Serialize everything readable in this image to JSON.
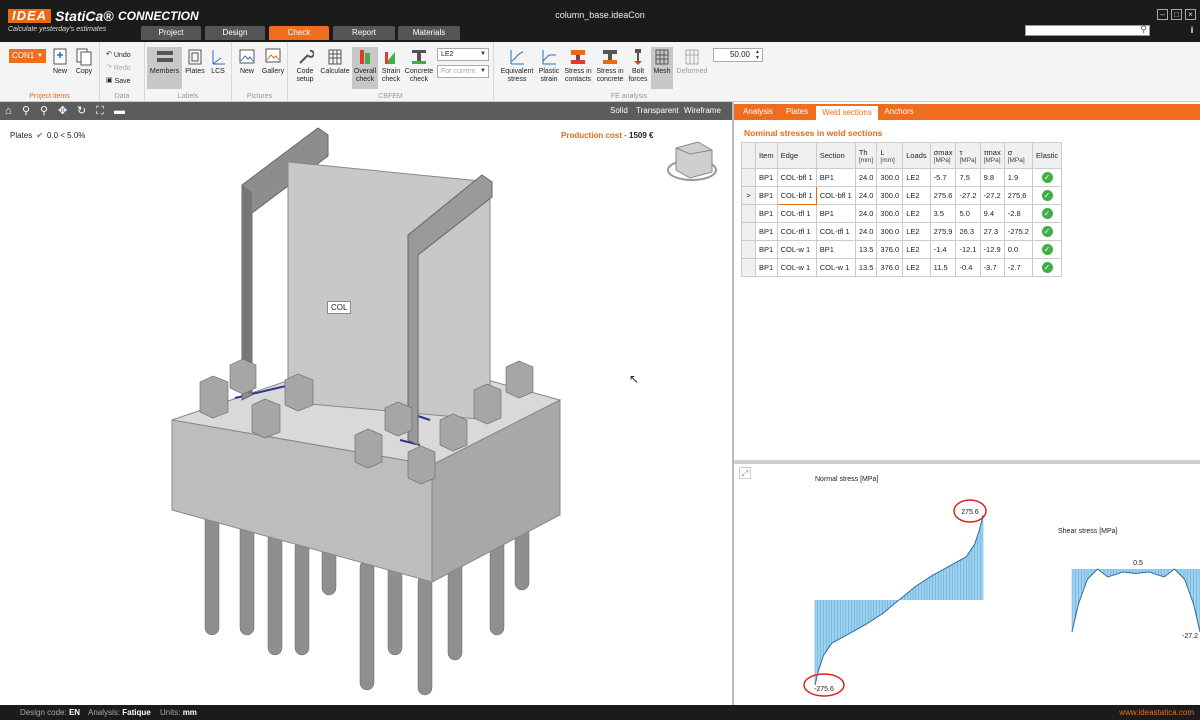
{
  "app": {
    "logo_mark": "IDEA",
    "logo_name": "StatiCa®",
    "logo_tagline": "Calculate yesterday's estimates",
    "product": "CONNECTION",
    "filename": "column_base.ideaCon",
    "min_label": "–",
    "max_label": "□",
    "close_label": "×",
    "info_label": "i"
  },
  "tabs": [
    "Project",
    "Design",
    "Check",
    "Report",
    "Materials"
  ],
  "active_tab": "Check",
  "ribbon": {
    "connection": "CON1",
    "new_label": "New",
    "copy_label": "Copy",
    "undo_label": "Undo",
    "redo_label": "Redo",
    "save_label": "Save",
    "members_label": "Members",
    "plates_label": "Plates",
    "lcs_label": "LCS",
    "pic_new_label": "New",
    "gallery_label": "Gallery",
    "code_setup_label": "Code setup",
    "calculate_label": "Calculate",
    "overall_check_label": "Overall check",
    "strain_check_label": "Strain check",
    "concrete_check_label": "Concrete check",
    "load_select": "LE2",
    "for_current": "For current",
    "equiv_stress_label": "Equivalent stress",
    "plastic_strain_label": "Plastic strain",
    "stress_contacts_label": "Stress in contacts",
    "stress_concrete_label": "Stress in concrete",
    "bolt_forces_label": "Bolt forces",
    "mesh_label": "Mesh",
    "deformed_label": "Deformed",
    "scale_value": "50.00",
    "groups": {
      "project_items": "Project items",
      "data": "Data",
      "labels": "Labels",
      "pictures": "Pictures",
      "cbfem": "CBFEM",
      "fe_analysis": "FE analysis"
    }
  },
  "viewbar": {
    "modes": [
      "Solid",
      "Transparent",
      "Wireframe"
    ]
  },
  "viewport": {
    "plates_label": "Plates",
    "plates_range": "0.0 < 5.0%",
    "production_cost_label": "Production cost",
    "production_cost_sep": "-",
    "production_cost_value": "1509 €",
    "member_label": "COL"
  },
  "right_tabs": [
    "Analysis",
    "Plates",
    "Weld sections",
    "Anchors"
  ],
  "active_right_tab": "Weld sections",
  "weld_table": {
    "title": "Nominal stresses in weld sections",
    "headers": {
      "item": "Item",
      "edge": "Edge",
      "section": "Section",
      "th": "Th",
      "th_u": "[mm]",
      "l": "L",
      "l_u": "[mm]",
      "loads": "Loads",
      "smax": "σmax",
      "smax_u": "[MPa]",
      "tau": "τ",
      "tau_u": "[MPa]",
      "tmax": "τmax",
      "tmax_u": "[MPa]",
      "sig": "σ",
      "sig_u": "[MPa]",
      "elastic": "Elastic"
    },
    "selected_row_marker": ">",
    "rows": [
      [
        "BP1",
        "COL-bfl 1",
        "BP1",
        "24.0",
        "300.0",
        "LE2",
        "-5.7",
        "7.5",
        "9.8",
        "1.9"
      ],
      [
        "BP1",
        "COL-bfl 1",
        "COL-bfl 1",
        "24.0",
        "300.0",
        "LE2",
        "275.6",
        "-27.2",
        "-27.2",
        "275.6"
      ],
      [
        "BP1",
        "COL-tfl 1",
        "BP1",
        "24.0",
        "300.0",
        "LE2",
        "3.5",
        "5.0",
        "9.4",
        "-2.8"
      ],
      [
        "BP1",
        "COL-tfl 1",
        "COL-tfl 1",
        "24.0",
        "300.0",
        "LE2",
        "275.9",
        "26.3",
        "27.3",
        "-275.2"
      ],
      [
        "BP1",
        "COL-w 1",
        "BP1",
        "13.5",
        "376.0",
        "LE2",
        "-1.4",
        "-12.1",
        "-12.9",
        "0.0"
      ],
      [
        "BP1",
        "COL-w 1",
        "COL-w 1",
        "13.5",
        "376.0",
        "LE2",
        "11.5",
        "-0.4",
        "-3.7",
        "-2.7"
      ]
    ],
    "elastic_mark": "✓"
  },
  "chart_data": [
    {
      "type": "area",
      "title": "Normal stress [MPa]",
      "xlabel": "",
      "ylabel": "",
      "data_labels": {
        "max": "275.6",
        "min": "-275.6"
      },
      "x": [
        0,
        0.02,
        0.05,
        0.1,
        0.2,
        0.3,
        0.4,
        0.5,
        0.6,
        0.7,
        0.8,
        0.9,
        0.95,
        0.98,
        1
      ],
      "y": [
        -275.6,
        -230,
        -180,
        -140,
        -110,
        -80,
        -45,
        0,
        45,
        80,
        110,
        140,
        180,
        230,
        275.6
      ],
      "ylim": [
        -275.6,
        275.6
      ]
    },
    {
      "type": "area",
      "title": "Shear stress [MPa]",
      "xlabel": "",
      "ylabel": "",
      "data_labels": {
        "peak": "0.5",
        "min": "-27.2"
      },
      "x": [
        0,
        0.05,
        0.12,
        0.2,
        0.28,
        0.4,
        0.5,
        0.6,
        0.72,
        0.8,
        0.88,
        0.95,
        1
      ],
      "y": [
        -27.2,
        -15,
        -4,
        0.5,
        -3,
        -0.8,
        -1.5,
        -0.8,
        -3,
        0.5,
        -4,
        -15,
        -27.2
      ],
      "ylim": [
        -27.2,
        0.5
      ]
    }
  ],
  "status": {
    "design_code_label": "Design code:",
    "design_code": "EN",
    "analysis_label": "Analysis:",
    "analysis": "Fatique",
    "units_label": "Units:",
    "units": "mm",
    "site": "www.ideastatica.com"
  }
}
